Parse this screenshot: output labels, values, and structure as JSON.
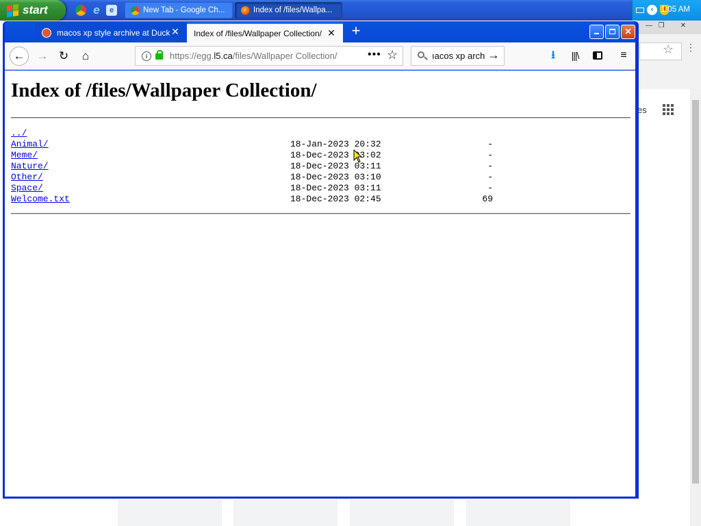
{
  "taskbar": {
    "start_label": "start",
    "tasks": [
      {
        "label": "New Tab - Google Ch..."
      },
      {
        "label": "Index of /files/Wallpa..."
      }
    ],
    "clock": "1:05 AM"
  },
  "background_window": {
    "partial_text": "es"
  },
  "browser": {
    "tabs": [
      {
        "label": "macos xp style archive at DuckDuc",
        "selected": false
      },
      {
        "label": "Index of /files/Wallpaper Collection/",
        "selected": true
      }
    ],
    "url_prefix": "https://egg.",
    "url_domain": "l5.ca",
    "url_path": "/files/Wallpaper Collection/",
    "search_value": "ıacos xp arch",
    "accent_color": "#0831d9"
  },
  "page": {
    "title": "Index of /files/Wallpaper Collection/",
    "parent_link": "../",
    "entries": [
      {
        "name": "Animal/",
        "date": "18-Jan-2023 20:32",
        "size": "-"
      },
      {
        "name": "Meme/",
        "date": "18-Dec-2023 03:02",
        "size": "-"
      },
      {
        "name": "Nature/",
        "date": "18-Dec-2023 03:11",
        "size": "-"
      },
      {
        "name": "Other/",
        "date": "18-Dec-2023 03:10",
        "size": "-"
      },
      {
        "name": "Space/",
        "date": "18-Dec-2023 03:11",
        "size": "-"
      },
      {
        "name": "Welcome.txt",
        "date": "18-Dec-2023 02:45",
        "size": "69"
      }
    ]
  }
}
